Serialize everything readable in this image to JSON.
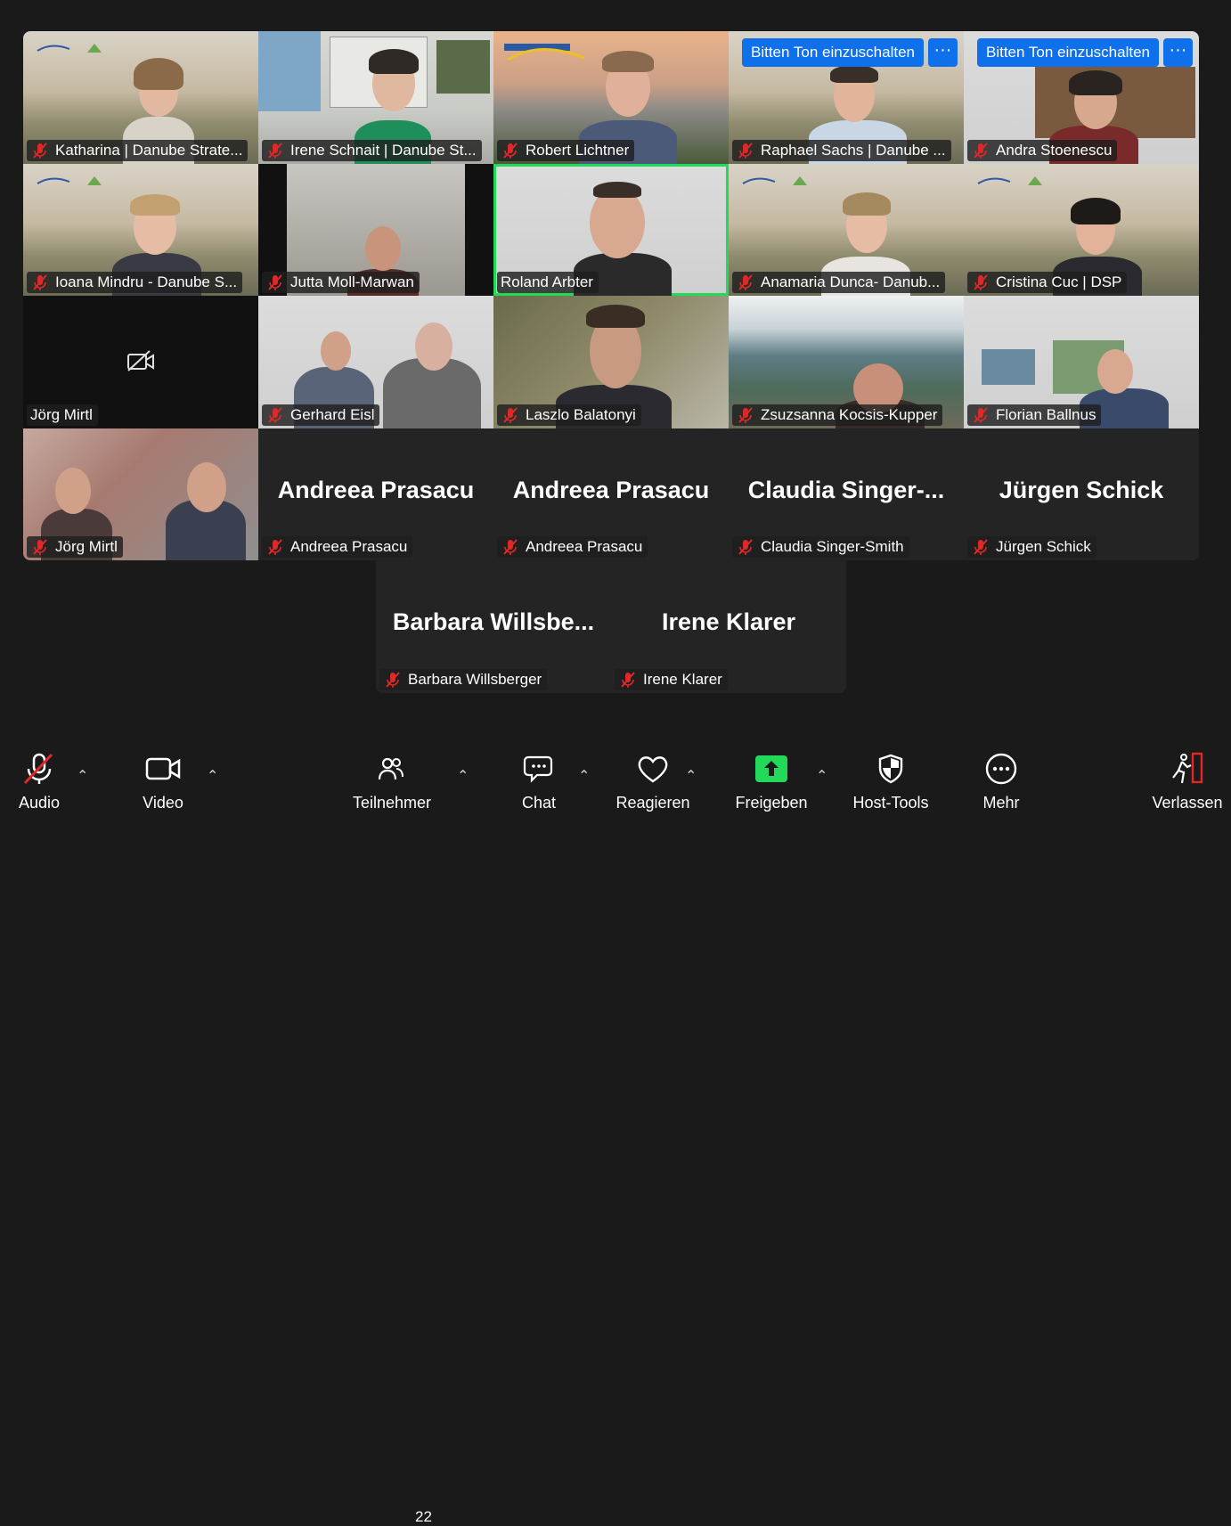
{
  "participants_grid": [
    {
      "name": "Katharina | Danube Strate...",
      "muted": true
    },
    {
      "name": "Irene Schnait | Danube St...",
      "muted": true
    },
    {
      "name": "Robert Lichtner",
      "muted": true
    },
    {
      "name": "Raphael Sachs | Danube ...",
      "muted": true,
      "request": "Bitten Ton einzuschalten"
    },
    {
      "name": "Andra Stoenescu",
      "muted": true,
      "request": "Bitten Ton einzuschalten"
    },
    {
      "name": "Ioana Mindru - Danube S...",
      "muted": true
    },
    {
      "name": "Jutta Moll-Marwan",
      "muted": true
    },
    {
      "name": "Roland Arbter",
      "muted": false,
      "active": true
    },
    {
      "name": "Anamaria Dunca- Danub...",
      "muted": true
    },
    {
      "name": "Cristina Cuc | DSP",
      "muted": true
    },
    {
      "name": "Jörg Mirtl",
      "muted": false,
      "video_off": true
    },
    {
      "name": "Gerhard Eisl",
      "muted": true
    },
    {
      "name": "Laszlo Balatonyi",
      "muted": true
    },
    {
      "name": "Zsuzsanna Kocsis-Kupper",
      "muted": true
    },
    {
      "name": "Florian Ballnus",
      "muted": true
    },
    {
      "name": "Jörg Mirtl",
      "muted": true
    },
    {
      "name": "Andreea Prasacu",
      "display": "Andreea Prasacu",
      "muted": true
    },
    {
      "name": "Andreea Prasacu",
      "display": "Andreea Prasacu",
      "muted": true
    },
    {
      "name": "Claudia Singer-Smith",
      "display": "Claudia  Singer-...",
      "muted": true
    },
    {
      "name": "Jürgen Schick",
      "display": "Jürgen Schick",
      "muted": true
    }
  ],
  "participants_row2": [
    {
      "name": "Barbara Willsberger",
      "display": "Barbara  Willsbe...",
      "muted": true
    },
    {
      "name": "Irene Klarer",
      "display": "Irene Klarer",
      "muted": true
    }
  ],
  "tile_more_label": "···",
  "toolbar": {
    "audio": "Audio",
    "video": "Video",
    "participants": "Teilnehmer",
    "participants_count": "22",
    "chat": "Chat",
    "react": "Reagieren",
    "share": "Freigeben",
    "host_tools": "Host-Tools",
    "more": "Mehr",
    "leave": "Verlassen"
  },
  "colors": {
    "accent_blue": "#0e71eb",
    "active_speaker": "#23d959",
    "share_green": "#23d959",
    "mute_red": "#e02828",
    "leave_red": "#e02828"
  }
}
